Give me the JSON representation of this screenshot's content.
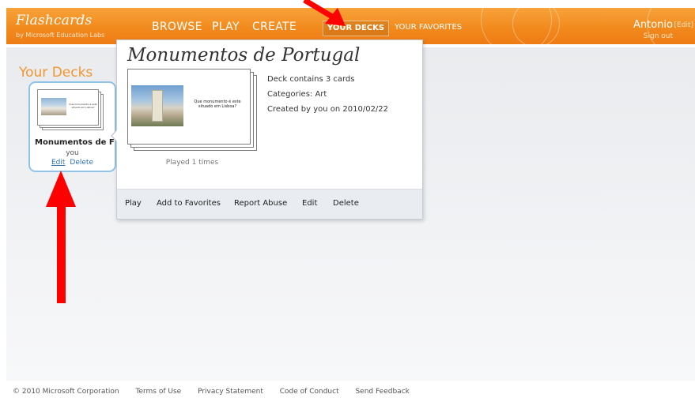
{
  "app": {
    "title": "Flashcards",
    "subtitle": "by Microsoft Education Labs"
  },
  "nav": {
    "browse": "BROWSE",
    "play": "PLAY",
    "create": "CREATE",
    "your_decks": "YOUR DECKS",
    "your_favorites": "YOUR FAVORITES"
  },
  "user": {
    "name": "Antonio",
    "edit": "[Edit]",
    "sign_out": "Sign out"
  },
  "page": {
    "title": "Your Decks"
  },
  "deck_tile": {
    "name": "Monumentos de F",
    "owner": "you",
    "edit": "Edit",
    "delete": "Delete",
    "card_text": "Que monumento é este situado em Lisboa?"
  },
  "popup": {
    "title": "Monumentos de Portugal",
    "card_text": "Que monumento é este situado em Lisboa?",
    "played": "Played 1 times",
    "info": [
      "Deck contains 3 cards",
      "Categories: Art",
      "Created by you on 2010/02/22"
    ],
    "actions": {
      "play": "Play",
      "add_to_favorites": "Add to Favorites",
      "report_abuse": "Report Abuse",
      "edit": "Edit",
      "delete": "Delete"
    }
  },
  "footer": {
    "copyright": "© 2010 Microsoft Corporation",
    "links": [
      "Terms of Use",
      "Privacy Statement",
      "Code of Conduct",
      "Send Feedback"
    ]
  },
  "colors": {
    "header_orange": "#f28a1e",
    "accent_orange": "#f0962e",
    "link_blue": "#2d6fb5",
    "annotation_red": "#ff0000"
  }
}
